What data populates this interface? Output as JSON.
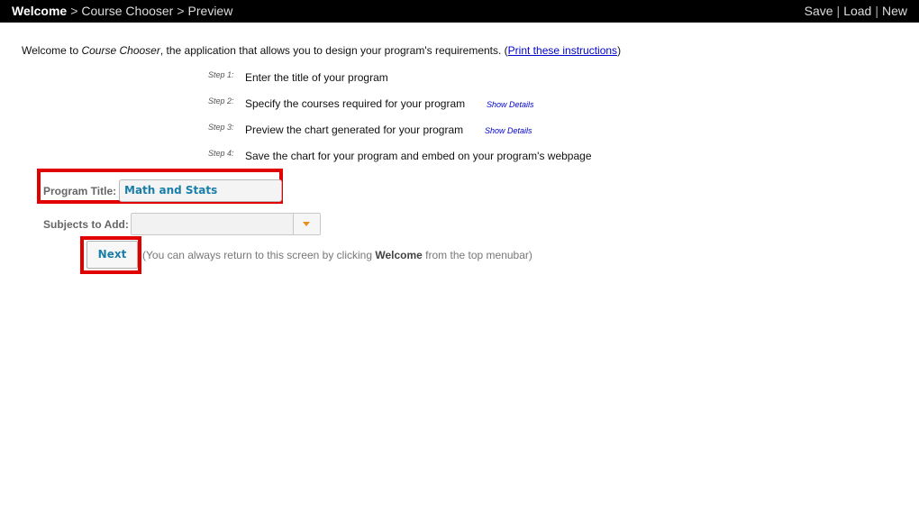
{
  "topbar": {
    "breadcrumbs": [
      "Welcome",
      "Course Chooser",
      "Preview"
    ],
    "breadcrumb_separator": ">",
    "menu": [
      "Save",
      "Load",
      "New"
    ],
    "menu_separator": "|"
  },
  "intro": {
    "prefix": "Welcome to ",
    "app_name": "Course Chooser",
    "suffix": ", the application that allows you to design your program's requirements. (",
    "link": "Print these instructions",
    "close": ")"
  },
  "steps": [
    {
      "num": "Step 1:",
      "text": "Enter the title of your program",
      "details": ""
    },
    {
      "num": "Step 2:",
      "text": "Specify the courses required for your program",
      "details": "Show Details"
    },
    {
      "num": "Step 3:",
      "text": "Preview the chart generated for your program",
      "details": "Show Details"
    },
    {
      "num": "Step 4:",
      "text": "Save the chart for your program and embed on your program's webpage",
      "details": ""
    }
  ],
  "form": {
    "title_label": "Program Title:",
    "title_value": "Math and Stats",
    "subjects_label": "Subjects to Add:",
    "subjects_value": ""
  },
  "next": {
    "label": "Next",
    "hint_prefix": "(You can always return to this screen by clicking ",
    "hint_bold": "Welcome",
    "hint_suffix": " from the top menubar)"
  },
  "colors": {
    "topbar_bg": "#000000",
    "highlight": "#e00000",
    "accent": "#1a7fa8",
    "link": "#0000cc"
  }
}
